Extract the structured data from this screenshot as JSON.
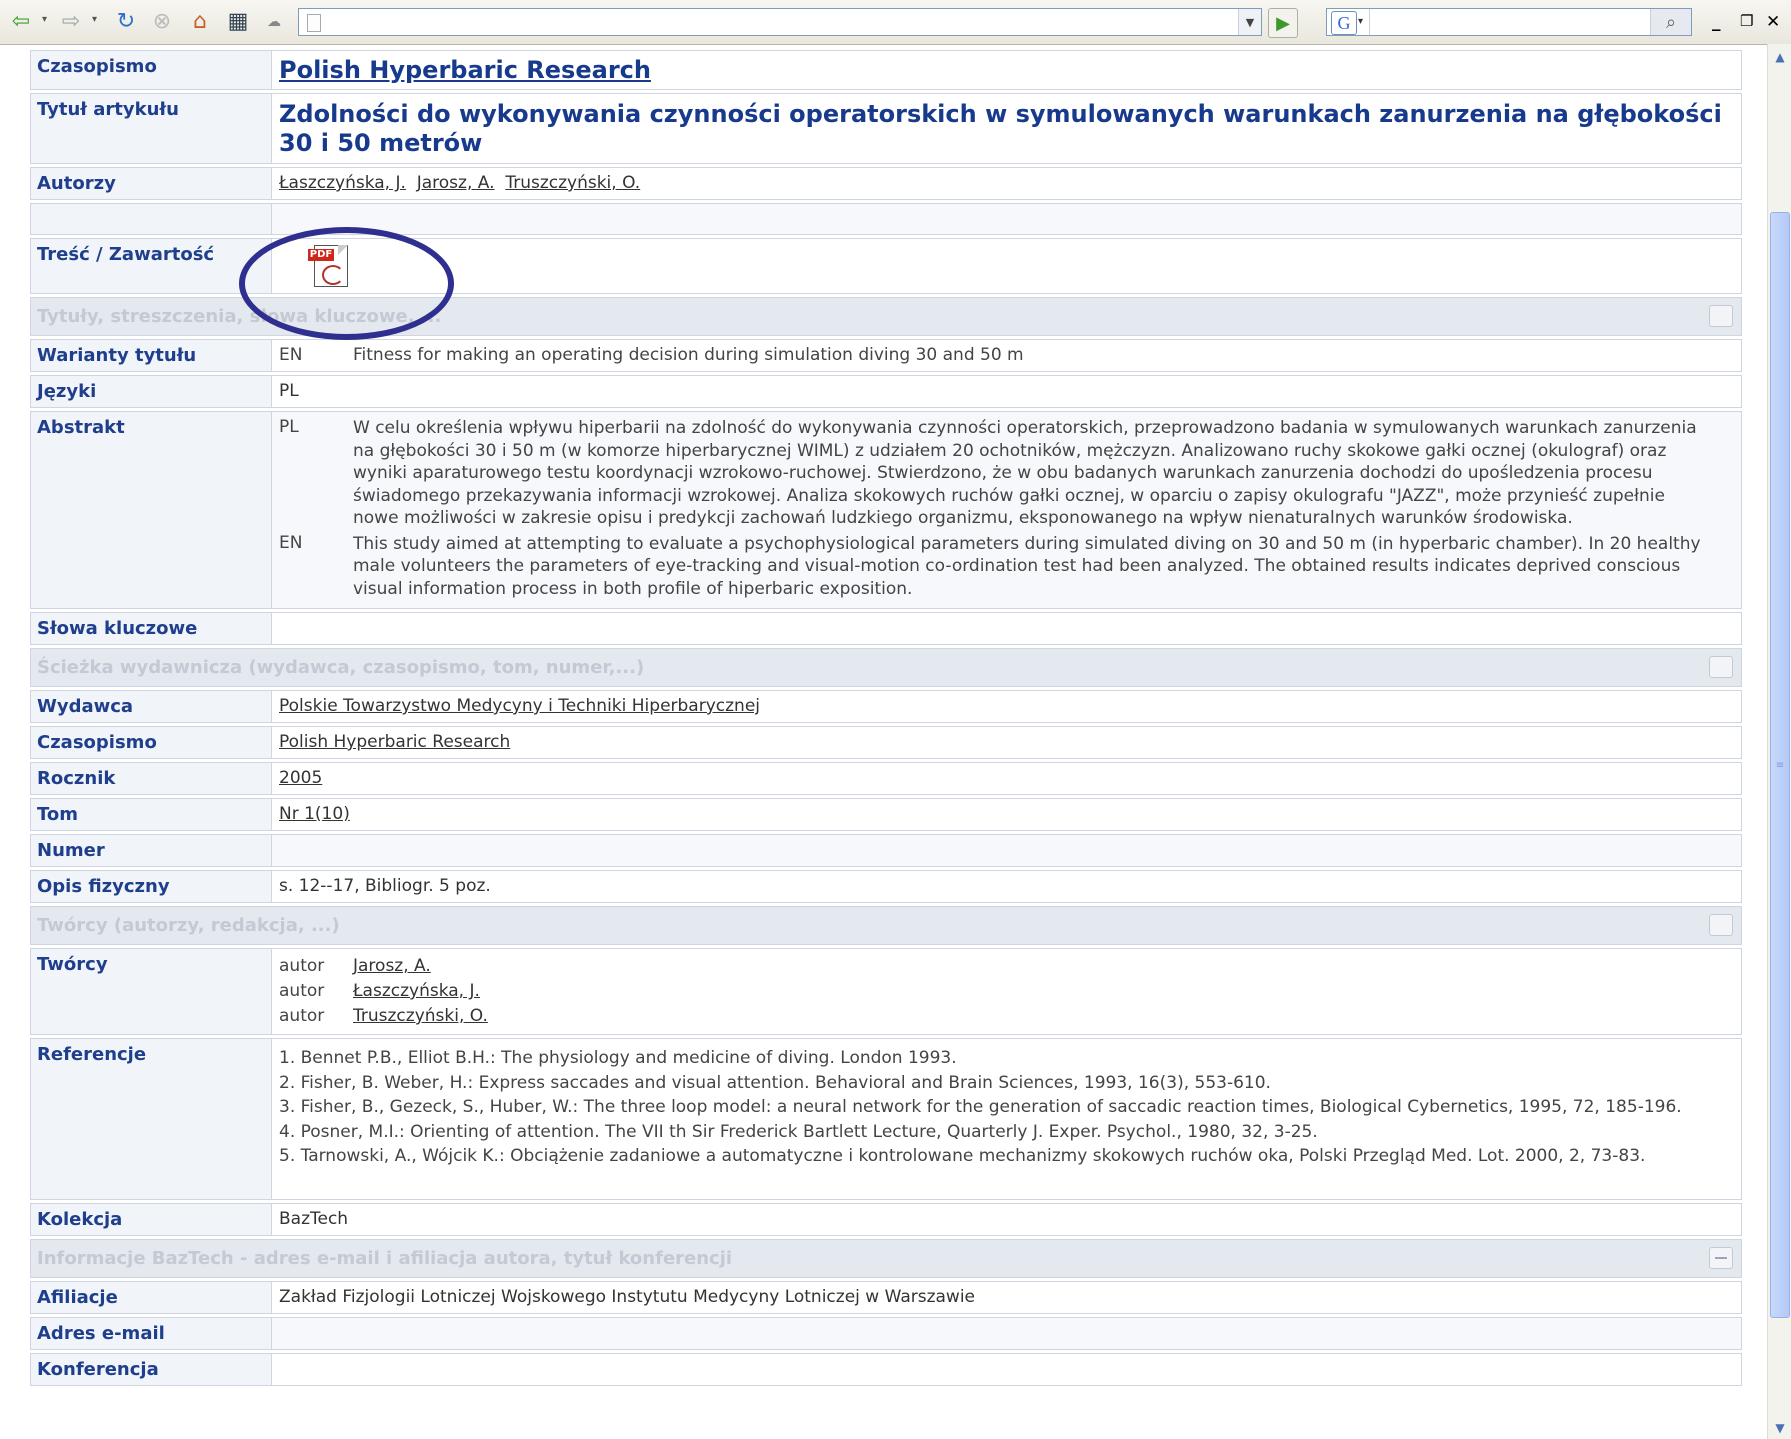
{
  "toolbar": {
    "back_icon": "back-arrow-icon",
    "forward_icon": "forward-arrow-icon",
    "address_value": "",
    "search_value": "",
    "google_letter": "G"
  },
  "record": {
    "czasopismo_label": "Czasopismo",
    "czasopismo_value": "Polish Hyperbaric Research",
    "tytul_label": "Tytuł artykułu",
    "tytul_value": "Zdolności do wykonywania czynności operatorskich w symulowanych warunkach zanurzenia na głębokości 30 i 50 metrów",
    "autorzy_label": "Autorzy",
    "autorzy": [
      "Łaszczyńska, J.",
      "Jarosz, A.",
      "Truszczyński, O."
    ],
    "tresc_label": "Treść / Zawartość",
    "pdf_label": "PDF",
    "sec_titles": "Tytuły, streszczenia, słowa kluczowe, ...",
    "warianty_label": "Warianty tytułu",
    "warianty_lang": "EN",
    "warianty_text": "Fitness for making an operating decision during simulation diving 30 and 50 m",
    "jezyki_label": "Języki",
    "jezyki_value": "PL",
    "abstrakt_label": "Abstrakt",
    "abstrakt_pl_lang": "PL",
    "abstrakt_pl": "W celu określenia wpływu hiperbarii na zdolność do wykonywania czynności operatorskich, przeprowadzono badania w symulowanych warunkach zanurzenia na głębokości 30 i 50 m (w komorze hiperbarycznej WIML) z udziałem 20 ochotników, mężczyzn. Analizowano ruchy skokowe gałki ocznej (okulograf) oraz wyniki aparaturowego testu koordynacji wzrokowo-ruchowej. Stwierdzono, że w obu badanych warunkach zanurzenia dochodzi do upośledzenia procesu świadomego przekazywania informacji wzrokowej. Analiza skokowych ruchów gałki ocznej, w oparciu o zapisy okulografu \"JAZZ\", może przynieść zupełnie nowe możliwości w zakresie opisu i predykcji zachowań ludzkiego organizmu, eksponowanego na wpływ nienaturalnych warunków środowiska.",
    "abstrakt_en_lang": "EN",
    "abstrakt_en": "This study aimed at attempting to evaluate a psychophysiological parameters during simulated diving on 30 and 50 m (in hyperbaric chamber). In 20 healthy male volunteers the parameters of eye-tracking and visual-motion co-ordination test had been analyzed. The obtained results indicates deprived conscious visual information process in both profile of hiperbaric exposition.",
    "slowa_label": "Słowa kluczowe",
    "slowa_value": "",
    "sec_path": "Ścieżka wydawnicza (wydawca, czasopismo, tom, numer,...)",
    "wydawca_label": "Wydawca",
    "wydawca_value": "Polskie Towarzystwo Medycyny i Techniki Hiperbarycznej",
    "czasopismo2_label": "Czasopismo",
    "czasopismo2_value": "Polish Hyperbaric Research",
    "rocznik_label": "Rocznik",
    "rocznik_value": "2005",
    "tom_label": "Tom",
    "tom_value": "Nr 1(10)",
    "numer_label": "Numer",
    "numer_value": "",
    "opis_label": "Opis fizyczny",
    "opis_value": "s. 12--17, Bibliogr. 5 poz.",
    "sec_tworcy": "Twórcy (autorzy, redakcja, ...)",
    "tworcy_label": "Twórcy",
    "tworcy": [
      {
        "role": "autor",
        "name": "Jarosz, A."
      },
      {
        "role": "autor",
        "name": "Łaszczyńska, J."
      },
      {
        "role": "autor",
        "name": "Truszczyński, O."
      }
    ],
    "referencje_label": "Referencje",
    "referencje": [
      "1. Bennet P.B., Elliot B.H.: The physiology and medicine of diving. London 1993.",
      "2. Fisher, B. Weber, H.: Express saccades and visual attention. Behavioral and Brain Sciences, 1993, 16(3), 553-610.",
      "3. Fisher, B., Gezeck, S., Huber, W.: The three loop model: a neural network for the generation of saccadic reaction times, Biological Cybernetics, 1995, 72, 185-196.",
      "4. Posner, M.I.: Orienting of attention. The VII th Sir Frederick Bartlett Lecture, Quarterly J. Exper. Psychol., 1980, 32, 3-25.",
      "5. Tarnowski, A., Wójcik K.: Obciążenie zadaniowe a automatyczne i kontrolowane mechanizmy skokowych ruchów oka, Polski Przegląd Med. Lot. 2000, 2, 73-83."
    ],
    "kolekcja_label": "Kolekcja",
    "kolekcja_value": "BazTech",
    "sec_info": "Informacje BazTech - adres e-mail i afiliacja autora, tytuł konferencji",
    "afiliacje_label": "Afiliacje",
    "afiliacje_value": "Zakład Fizjologii Lotniczej Wojskowego Instytutu Medycyny Lotniczej w Warszawie",
    "email_label": "Adres e-mail",
    "email_value": "",
    "konferencja_label": "Konferencja"
  }
}
